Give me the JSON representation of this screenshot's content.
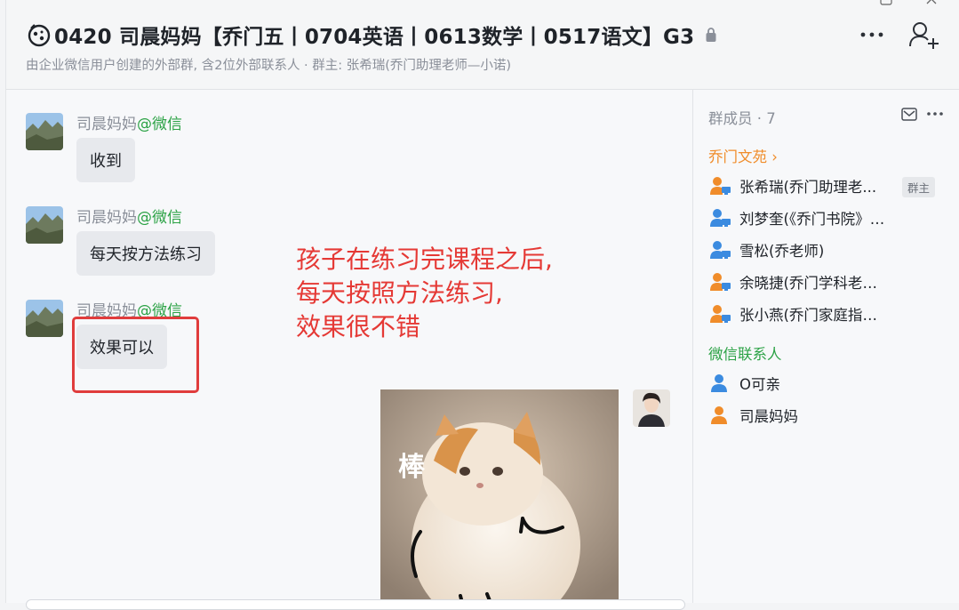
{
  "header": {
    "title": "0420 司晨妈妈【乔门五丨0704英语丨0613数学丨0517语文】G3",
    "subtitle": "由企业微信用户创建的外部群, 含2位外部联系人 · 群主: 张希瑞(乔门助理老师—小诺)"
  },
  "messages": [
    {
      "sender": "司晨妈妈",
      "source": "@微信",
      "text": "收到"
    },
    {
      "sender": "司晨妈妈",
      "source": "@微信",
      "text": "每天按方法练习"
    },
    {
      "sender": "司晨妈妈",
      "source": "@微信",
      "text": "效果可以"
    }
  ],
  "annotation": {
    "line1": "孩子在练习完课程之后,",
    "line2": "每天按照方法练习,",
    "line3": "效果很不错"
  },
  "sticker": {
    "text": "棒"
  },
  "side": {
    "members_title": "群成员 · 7",
    "group1_title": "乔门文苑",
    "group1_members": [
      {
        "name": "张希瑞(乔门助理老...",
        "badge": "群主"
      },
      {
        "name": "刘梦奎(《乔门书院》国家..."
      },
      {
        "name": "雪松(乔老师)"
      },
      {
        "name": "余晓捷(乔门学科老师——..."
      },
      {
        "name": "张小燕(乔门家庭指导师-西..."
      }
    ],
    "group2_title": "微信联系人",
    "group2_members": [
      {
        "name": "O可亲"
      },
      {
        "name": "司晨妈妈"
      }
    ]
  },
  "colors": {
    "accent_orange": "#f08c2a",
    "accent_green": "#2ba245",
    "annotation_red": "#e53935",
    "member_blue": "#3b8be0"
  }
}
